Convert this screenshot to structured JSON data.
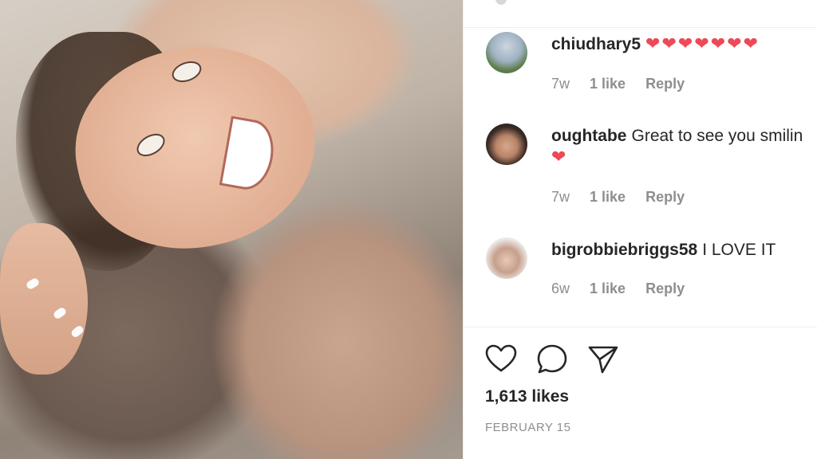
{
  "post": {
    "likes": "1,613 likes",
    "date": "FEBRUARY 15"
  },
  "comments": [
    {
      "username": "chiudhary5",
      "text": "",
      "hearts": "❤❤❤❤❤❤❤",
      "age": "7w",
      "likes": "1 like",
      "reply": "Reply"
    },
    {
      "username": "oughtabe",
      "text": "Great to see you smilin",
      "hearts": "❤",
      "age": "7w",
      "likes": "1 like",
      "reply": "Reply"
    },
    {
      "username": "bigrobbiebriggs58",
      "text": "I LOVE IT",
      "hearts": "",
      "age": "6w",
      "likes": "1 like",
      "reply": "Reply"
    }
  ],
  "icons": {
    "like": "heart-icon",
    "comment": "comment-bubble-icon",
    "share": "paper-plane-icon"
  },
  "colors": {
    "heart": "#ed4956",
    "text": "#262626",
    "muted": "#8e8e8e",
    "divider": "#efefef"
  }
}
